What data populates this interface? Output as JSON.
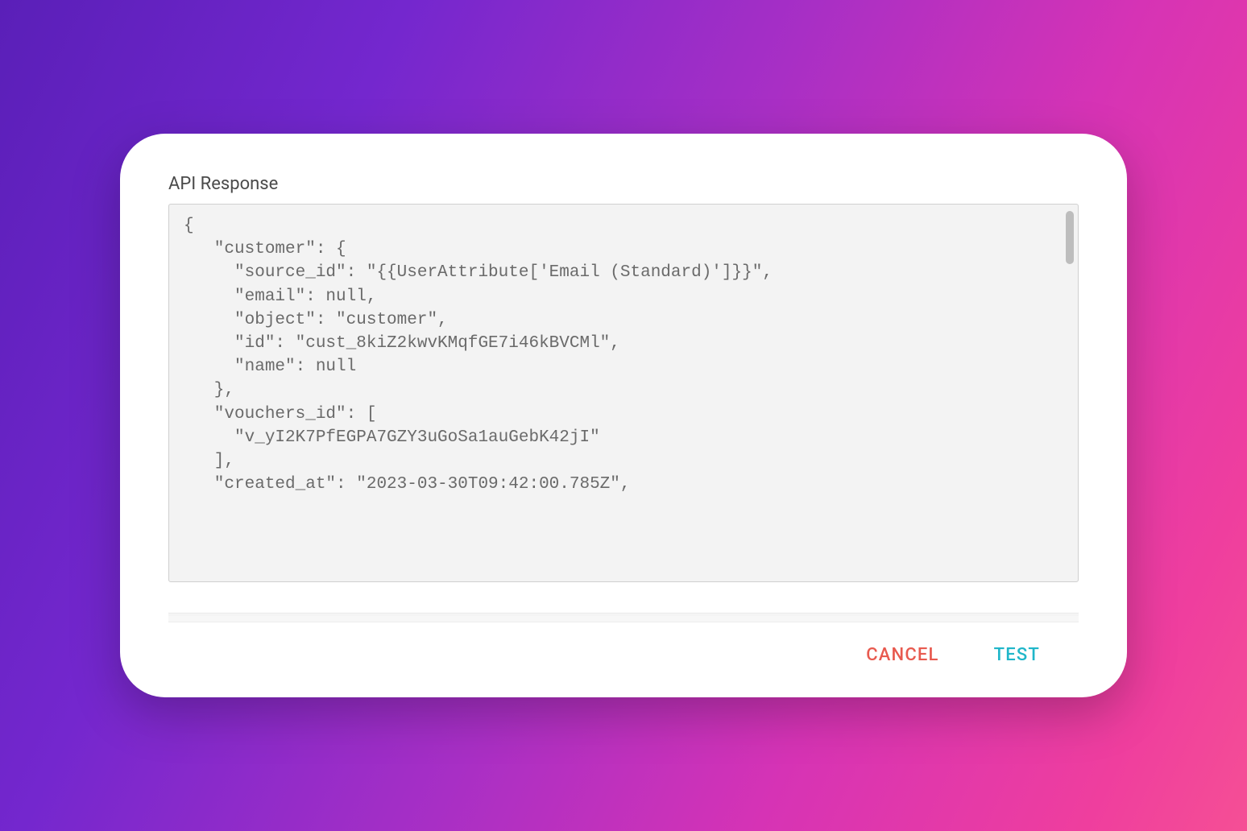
{
  "section_label": "API Response",
  "response_body": "{\n   \"customer\": {\n     \"source_id\": \"{{UserAttribute['Email (Standard)']}}\",\n     \"email\": null,\n     \"object\": \"customer\",\n     \"id\": \"cust_8kiZ2kwvKMqfGE7i46kBVCMl\",\n     \"name\": null\n   },\n   \"vouchers_id\": [\n     \"v_yI2K7PfEGPA7GZY3uGoSa1auGebK42jI\"\n   ],\n   \"created_at\": \"2023-03-30T09:42:00.785Z\",",
  "footer": {
    "cancel_label": "CANCEL",
    "test_label": "TEST"
  }
}
